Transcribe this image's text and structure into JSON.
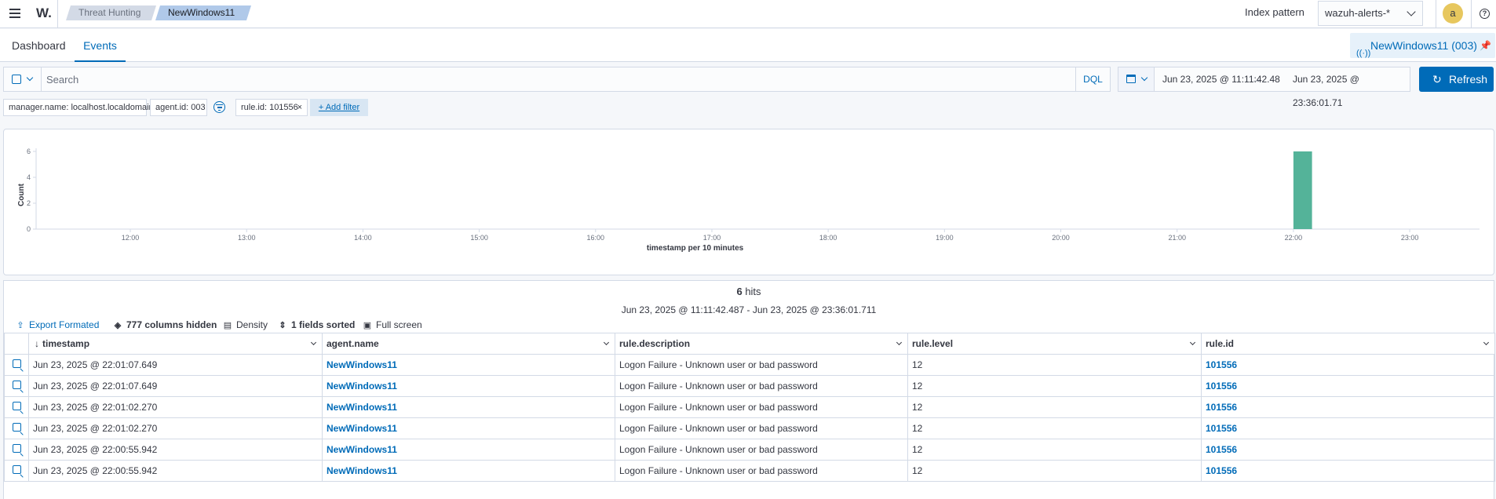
{
  "header": {
    "logo": "W.",
    "breadcrumbs": [
      "Threat Hunting",
      "NewWindows11"
    ],
    "index_pattern_label": "Index pattern",
    "index_pattern_value": "wazuh-alerts-*",
    "avatar_letter": "a",
    "help_glyph": "?"
  },
  "tabs": {
    "dashboard": "Dashboard",
    "events": "Events",
    "agent_pill": "NewWindows11 (003)"
  },
  "search": {
    "placeholder": "Search",
    "dql_label": "DQL",
    "date_start": "Jun 23, 2025 @ 11:11:42.48",
    "date_arrow": "→",
    "date_end": "Jun 23, 2025 @ 23:36:01.71",
    "refresh_label": "Refresh"
  },
  "filters": {
    "pills": [
      "manager.name: localhost.localdomain",
      "agent.id: 003",
      "rule.id: 101556"
    ],
    "remove_glyph": "×",
    "add_filter": "+ Add filter"
  },
  "chart_data": {
    "type": "bar",
    "xlabel": "timestamp per 10 minutes",
    "ylabel": "Count",
    "yticks": [
      0,
      2,
      4,
      6
    ],
    "ylim": [
      0,
      6
    ],
    "xticks": [
      "12:00",
      "13:00",
      "14:00",
      "15:00",
      "16:00",
      "17:00",
      "18:00",
      "19:00",
      "20:00",
      "21:00",
      "22:00",
      "23:00"
    ],
    "xrange_hours": [
      11.19,
      23.6
    ],
    "bars": [
      {
        "x": "22:00",
        "value": 6
      }
    ],
    "bar_color": "#54b399",
    "grid": false
  },
  "results": {
    "hits_count": "6",
    "hits_label": "hits",
    "range": "Jun 23, 2025 @ 11:11:42.487 - Jun 23, 2025 @ 23:36:01.711",
    "toolbar": {
      "export": "Export Formated",
      "columns_hidden": "777 columns hidden",
      "density": "Density",
      "sorted": "1 fields sorted",
      "fullscreen": "Full screen"
    },
    "columns": [
      "timestamp",
      "agent.name",
      "rule.description",
      "rule.level",
      "rule.id"
    ],
    "rows": [
      [
        "Jun 23, 2025 @ 22:01:07.649",
        "NewWindows11",
        "Logon Failure - Unknown user or bad password",
        "12",
        "101556"
      ],
      [
        "Jun 23, 2025 @ 22:01:07.649",
        "NewWindows11",
        "Logon Failure - Unknown user or bad password",
        "12",
        "101556"
      ],
      [
        "Jun 23, 2025 @ 22:01:02.270",
        "NewWindows11",
        "Logon Failure - Unknown user or bad password",
        "12",
        "101556"
      ],
      [
        "Jun 23, 2025 @ 22:01:02.270",
        "NewWindows11",
        "Logon Failure - Unknown user or bad password",
        "12",
        "101556"
      ],
      [
        "Jun 23, 2025 @ 22:00:55.942",
        "NewWindows11",
        "Logon Failure - Unknown user or bad password",
        "12",
        "101556"
      ],
      [
        "Jun 23, 2025 @ 22:00:55.942",
        "NewWindows11",
        "Logon Failure - Unknown user or bad password",
        "12",
        "101556"
      ]
    ]
  }
}
